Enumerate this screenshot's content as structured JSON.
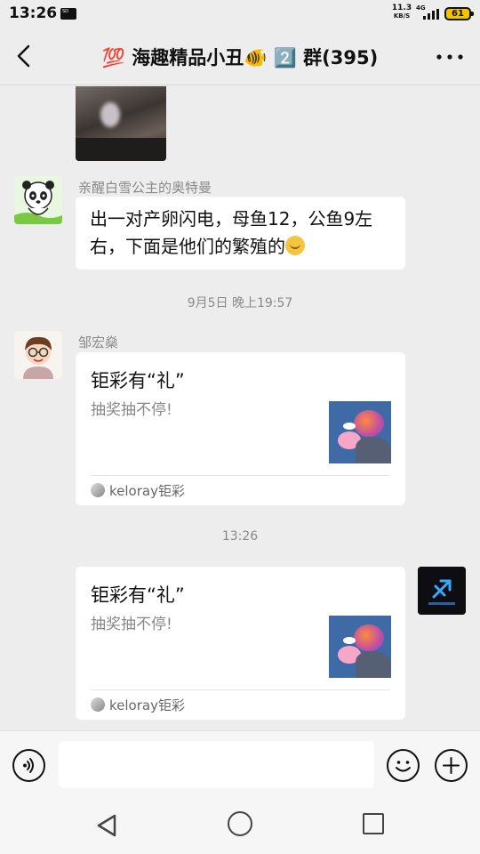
{
  "status_bar": {
    "time": "13:26",
    "net_speed_value": "11.3",
    "net_speed_unit": "KB/S",
    "network": "4G",
    "battery": "61"
  },
  "header": {
    "title": "💯 海趣精品小丑🐠 2️⃣ 群(395)",
    "back_icon": "back-chevron-icon",
    "more_icon": "more-dots-icon"
  },
  "messages": {
    "m1": {
      "sender": "亲醒白雪公主的奥特曼",
      "text": "出一对产卵闪电，母鱼12，公鱼9左右，下面是他们的繁殖的"
    },
    "timestamp1": "9月5日 晚上19:57",
    "m2": {
      "sender": "邹宏燊",
      "card_title": "钜彩有“礼”",
      "card_desc": "抽奖抽不停!",
      "card_source": "keloray钜彩"
    },
    "timestamp2": "13:26",
    "m3": {
      "card_title": "钜彩有“礼”",
      "card_desc": "抽奖抽不停!",
      "card_source": "keloray钜彩"
    }
  },
  "input": {
    "placeholder": "",
    "value": ""
  },
  "colors": {
    "background": "#ededed",
    "bubble": "#ffffff",
    "secondary_text": "#8a8a8a"
  }
}
